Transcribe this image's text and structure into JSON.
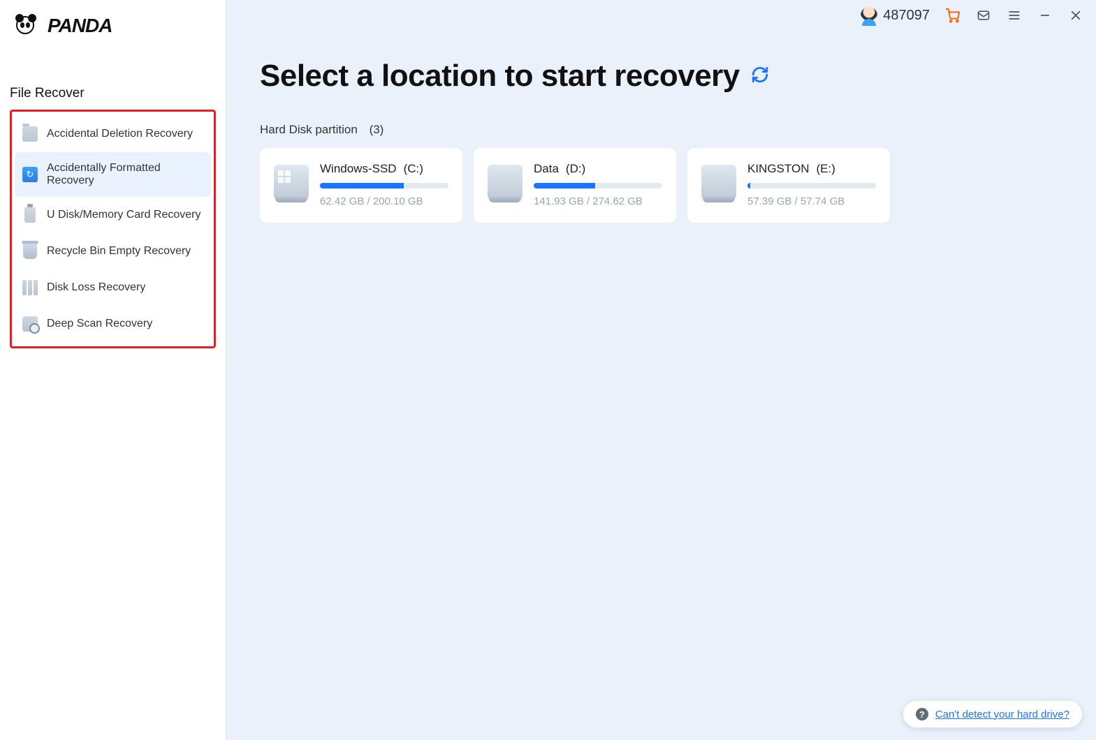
{
  "brand": {
    "name": "PANDA"
  },
  "sidebar": {
    "section_title": "File Recover",
    "items": [
      {
        "label": "Accidental Deletion Recovery",
        "active": false
      },
      {
        "label": "Accidentally Formatted Recovery",
        "active": true
      },
      {
        "label": "U Disk/Memory Card Recovery",
        "active": false
      },
      {
        "label": "Recycle Bin Empty Recovery",
        "active": false
      },
      {
        "label": "Disk Loss Recovery",
        "active": false
      },
      {
        "label": "Deep Scan Recovery",
        "active": false
      }
    ]
  },
  "topbar": {
    "user_id": "487097"
  },
  "main": {
    "title": "Select a location to start recovery",
    "section_label": "Hard Disk partition",
    "section_count": "(3)"
  },
  "disks": [
    {
      "name": "Windows-SSD",
      "letter": "(C:)",
      "used_text": "62.42 GB / 200.10 GB",
      "fill_pct": 65,
      "kind": "win"
    },
    {
      "name": "Data",
      "letter": "(D:)",
      "used_text": "141.93 GB / 274.62 GB",
      "fill_pct": 48,
      "kind": "hdd"
    },
    {
      "name": "KINGSTON",
      "letter": "(E:)",
      "used_text": "57.39 GB / 57.74 GB",
      "fill_pct": 2,
      "kind": "hdd"
    }
  ],
  "help": {
    "link_text": "Can't detect your hard drive?"
  }
}
